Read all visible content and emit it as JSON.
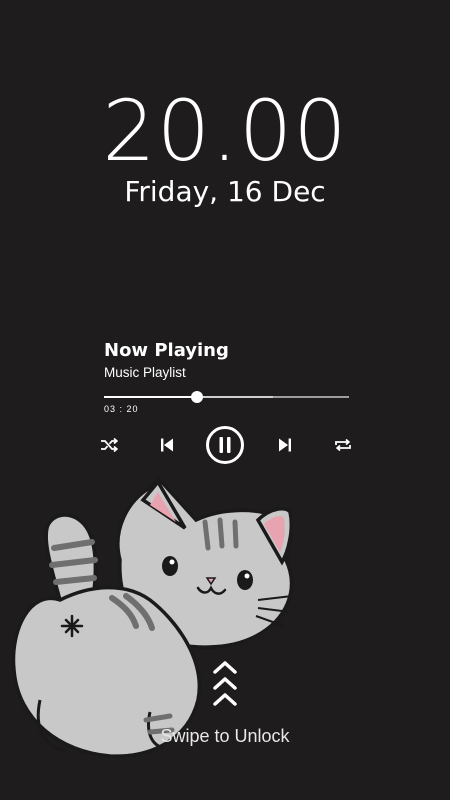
{
  "lockscreen": {
    "time": "20.00",
    "date": "Friday, 16 Dec"
  },
  "player": {
    "title": "Now Playing",
    "subtitle": "Music Playlist",
    "elapsed": "03 : 20",
    "progress_fraction": 0.38,
    "buffered_fraction": 0.69
  },
  "controls": {
    "icons": [
      "shuffle-icon",
      "previous-icon",
      "pause-icon",
      "next-icon",
      "repeat-icon"
    ]
  },
  "unlock": {
    "label": "Swipe to Unlock"
  },
  "colors": {
    "background": "#1e1c1d",
    "cat_fur": "#c8c8c8",
    "cat_stripes": "#6f6f6f",
    "ear_inner": "#e8a3b0"
  }
}
